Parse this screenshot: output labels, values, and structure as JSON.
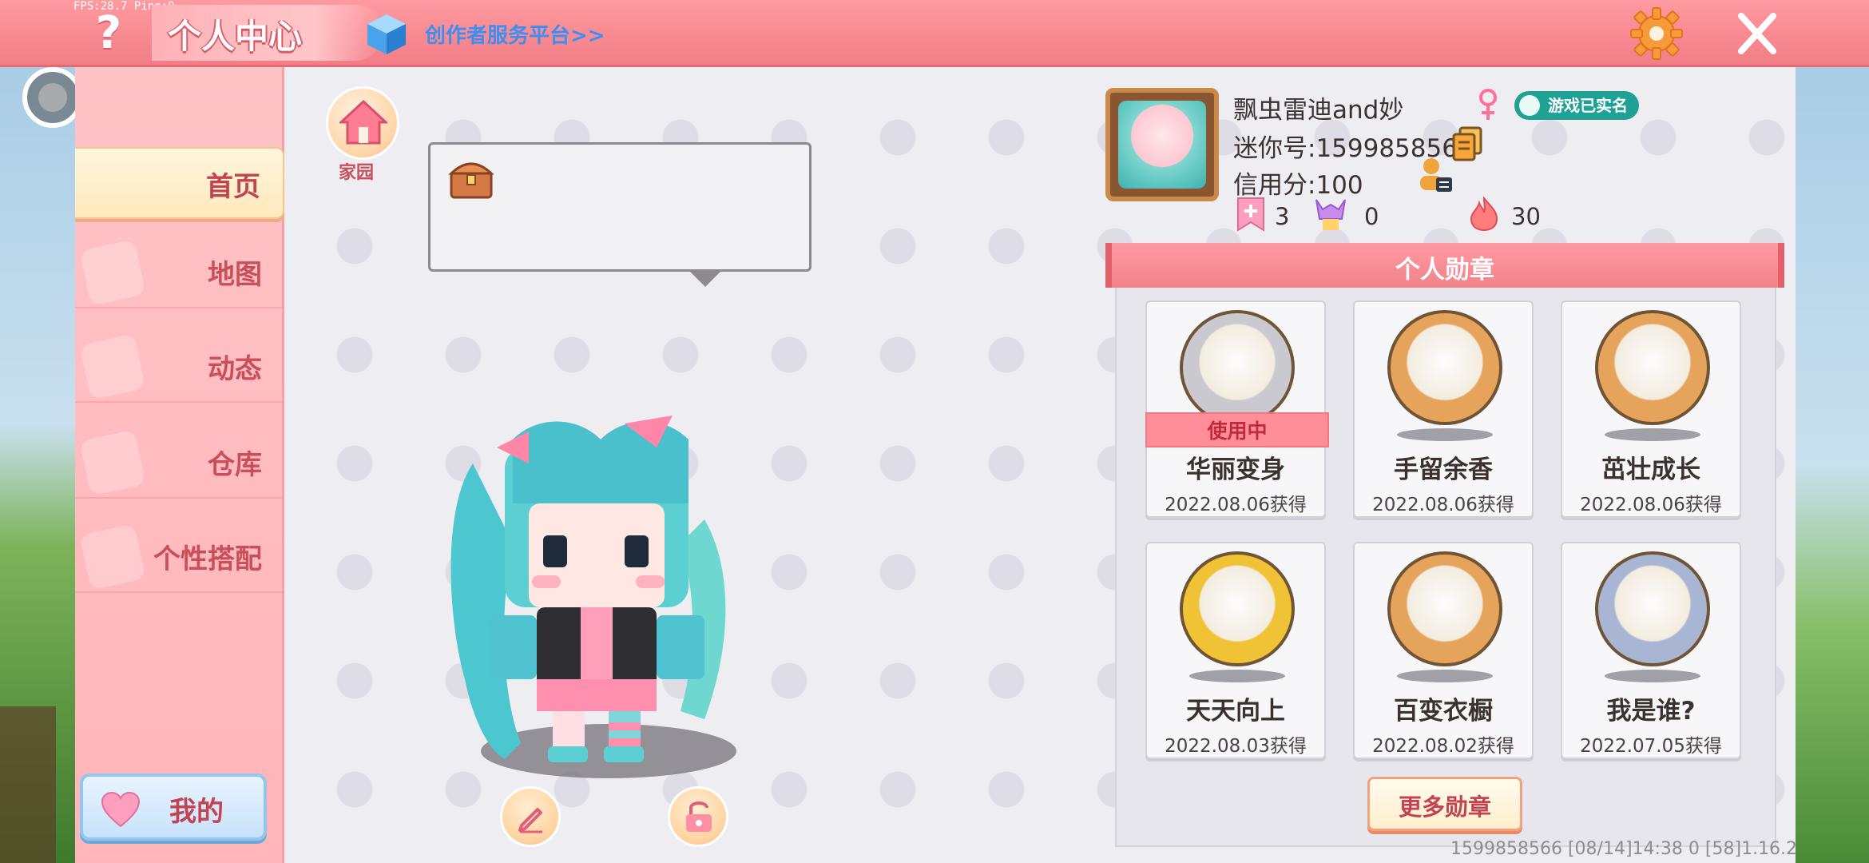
{
  "debug": {
    "text": "FPS:28.7 Ping:0"
  },
  "header": {
    "help_label": "?",
    "title": "个人中心",
    "creator_link": "创作者服务平台>>"
  },
  "nav": {
    "items": [
      {
        "label": "首页",
        "active": true
      },
      {
        "label": "地图",
        "active": false
      },
      {
        "label": "动态",
        "active": false
      },
      {
        "label": "仓库",
        "active": false
      },
      {
        "label": "个性搭配",
        "active": false
      }
    ],
    "mine_label": "我的"
  },
  "home": {
    "label": "家园"
  },
  "profile": {
    "name": "飘虫雷迪and妙",
    "gender_icon": "female-icon",
    "realname_badge": "游戏已实名",
    "mini_id": "迷你号:1599858566",
    "credit": "信用分:100",
    "stats": [
      {
        "icon": "bookmark-plus-icon",
        "value": "3"
      },
      {
        "icon": "fans-icon",
        "value": "0"
      },
      {
        "icon": "flame-icon",
        "value": "30"
      }
    ]
  },
  "medals": {
    "header": "个人勋章",
    "in_use_label": "使用中",
    "items": [
      {
        "name": "华丽变身",
        "date": "2022.08.06获得",
        "in_use": true,
        "color": "#c9c9cf"
      },
      {
        "name": "手留余香",
        "date": "2022.08.06获得",
        "in_use": false,
        "color": "#e6a35c"
      },
      {
        "name": "茁壮成长",
        "date": "2022.08.06获得",
        "in_use": false,
        "color": "#e6a35c"
      },
      {
        "name": "天天向上",
        "date": "2022.08.03获得",
        "in_use": false,
        "color": "#f0c235"
      },
      {
        "name": "百变衣橱",
        "date": "2022.08.02获得",
        "in_use": false,
        "color": "#e6a35c"
      },
      {
        "name": "我是谁?",
        "date": "2022.07.05获得",
        "in_use": false,
        "color": "#a9b6d3"
      }
    ],
    "more_label": "更多勋章"
  },
  "footer": {
    "text": "1599858566   [08/14]14:38 0  [58]1.16.2"
  },
  "colors": {
    "topbar": "#f27d86",
    "nav_bg": "#ffb5b9",
    "accent_text": "#c24351",
    "link_blue": "#3d8ef0"
  }
}
